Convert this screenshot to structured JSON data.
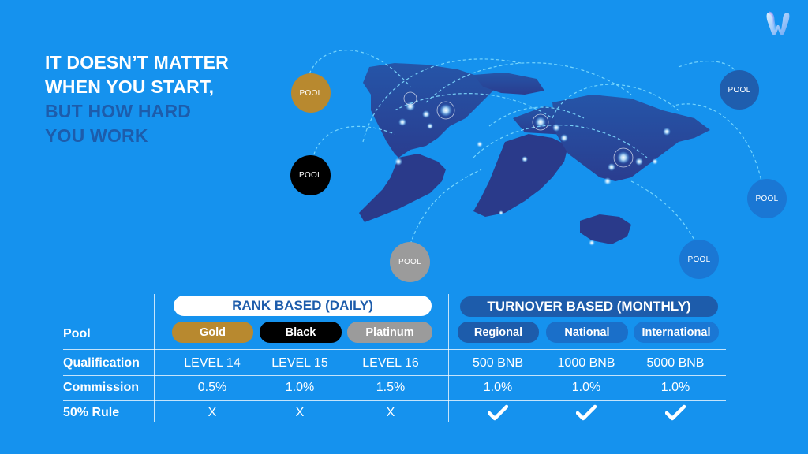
{
  "brand": {
    "logo_icon": "w-logo-icon"
  },
  "headline": {
    "line1": "IT DOESN’T MATTER",
    "line2": "WHEN YOU START,",
    "line3": "BUT HOW HARD",
    "line4": "YOU WORK"
  },
  "map": {
    "pools": [
      {
        "label": "POOL",
        "color": "#b8892f"
      },
      {
        "label": "POOL",
        "color": "#000000"
      },
      {
        "label": "POOL",
        "color": "#9b9b9b"
      },
      {
        "label": "POOL",
        "color": "#1f5eae"
      },
      {
        "label": "POOL",
        "color": "#1a77d4"
      },
      {
        "label": "POOL",
        "color": "#1a77d4"
      }
    ]
  },
  "table": {
    "groups": [
      {
        "label": "RANK BASED (DAILY)",
        "bg": "#ffffff",
        "fg": "#1d5cab"
      },
      {
        "label": "TURNOVER BASED (MONTHLY)",
        "bg": "#1d5cab",
        "fg": "#ffffff"
      }
    ],
    "row_labels": [
      "Pool",
      "Qualification",
      "Commission",
      "50% Rule"
    ],
    "pools": [
      {
        "name": "Gold",
        "bg": "#b8892f",
        "qualification": "LEVEL 14",
        "commission": "0.5%",
        "rule": "X",
        "rule_icon": "x-mark"
      },
      {
        "name": "Black",
        "bg": "#000000",
        "qualification": "LEVEL 15",
        "commission": "1.0%",
        "rule": "X",
        "rule_icon": "x-mark"
      },
      {
        "name": "Platinum",
        "bg": "#9b9b9b",
        "qualification": "LEVEL 16",
        "commission": "1.5%",
        "rule": "X",
        "rule_icon": "x-mark"
      },
      {
        "name": "Regional",
        "bg": "#1d5cab",
        "qualification": "500 BNB",
        "commission": "1.0%",
        "rule": "",
        "rule_icon": "checkmark-icon"
      },
      {
        "name": "National",
        "bg": "#1a6fc9",
        "qualification": "1000 BNB",
        "commission": "1.0%",
        "rule": "",
        "rule_icon": "checkmark-icon"
      },
      {
        "name": "International",
        "bg": "#1a77d4",
        "qualification": "5000 BNB",
        "commission": "1.0%",
        "rule": "",
        "rule_icon": "checkmark-icon"
      }
    ]
  }
}
